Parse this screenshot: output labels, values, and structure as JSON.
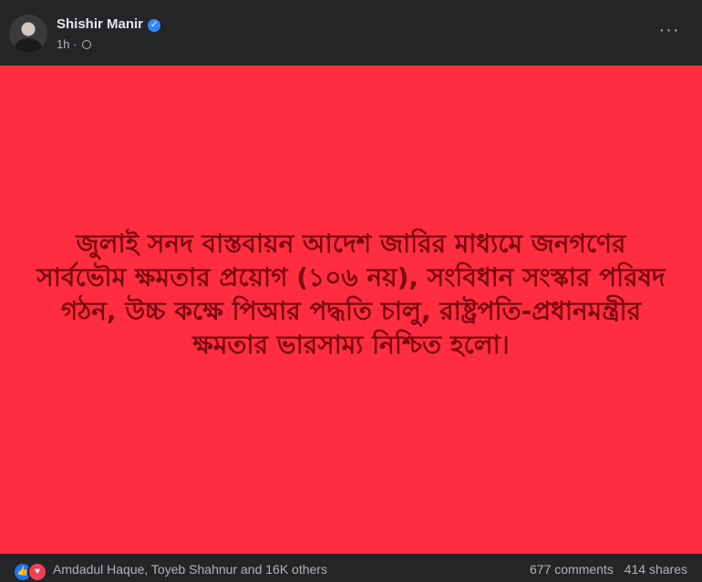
{
  "post": {
    "author": "Shishir Manir",
    "time": "1h",
    "separator": "·",
    "privacy_icon": "globe-icon",
    "more_icon": "more-options-icon",
    "more_label": "···",
    "verified_icon": "verified-badge-icon",
    "verified_glyph": "✓",
    "background_color": "#ff2d3f",
    "text_color": "#7a0a0f",
    "text": "জুলাই সনদ বাস্তবায়ন আদেশ জারির মাধ্যমে জনগণের সার্বভৌম ক্ষমতার প্রয়োগ (১০৬ নয়), সংবিধান সংস্কার পরিষদ গঠন, উচ্চ কক্ষে পিআর পদ্ধতি চালু, রাষ্ট্রপতি-প্রধানমন্ত্রীর ক্ষমতার ভারসাম্য নিশ্চিত হলো।"
  },
  "footer": {
    "reaction_icons": [
      "like-icon",
      "love-icon"
    ],
    "like_glyph": "👍",
    "love_glyph": "♥",
    "reactors": "Amdadul Haque, Toyeb Shahnur and 16K others",
    "comments": "677 comments",
    "shares": "414 shares"
  }
}
